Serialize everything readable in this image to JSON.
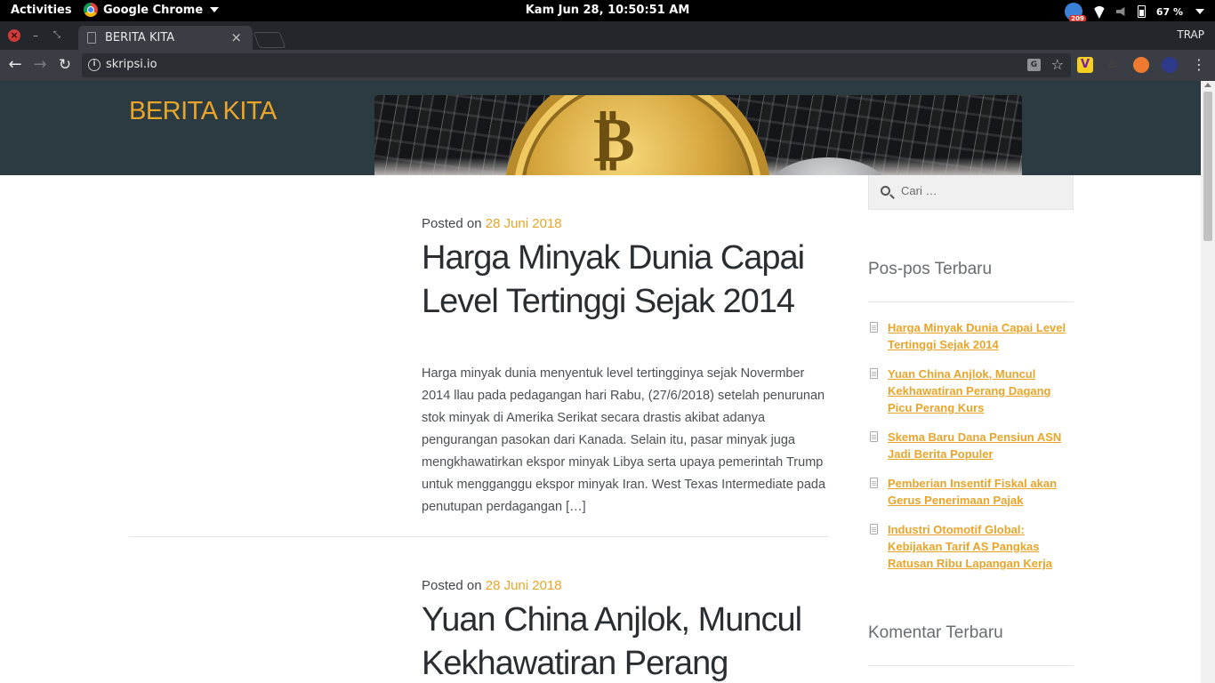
{
  "system_bar": {
    "activities": "Activities",
    "app_name": "Google Chrome",
    "clock": "Kam Jun 28, 10:50:51 AM",
    "notification_count": "209",
    "battery": "67 %"
  },
  "browser": {
    "tab_title": "BERITA KITA",
    "tab_close": "×",
    "profile": "TRAP",
    "url": "skripsi.io",
    "window_close": "×",
    "window_min": "–",
    "window_max": "⤡",
    "nav_back": "←",
    "nav_forward": "→",
    "nav_reload": "↻",
    "bookmark": "☆",
    "menu": "⋮",
    "extension_v": "V"
  },
  "site": {
    "title": "BERITA KITA",
    "header_image_glyph": "₿"
  },
  "posts": [
    {
      "posted_label": "Posted on",
      "date": "28 Juni 2018",
      "title": "Harga Minyak Dunia Capai Level Tertinggi Sejak 2014",
      "excerpt": "Harga minyak dunia menyentuk level tertingginya sejak Novermber 2014 llau pada pedagangan hari Rabu, (27/6/2018) setelah penurunan stok minyak di Amerika Serikat secara drastis akibat adanya pengurangan pasokan dari Kanada. Selain itu, pasar minyak juga mengkhawatirkan ekspor minyak Libya serta upaya pemerintah Trump untuk mengganggu ekspor minyak Iran. West Texas Intermediate pada penutupan perdagangan […]"
    },
    {
      "posted_label": "Posted on",
      "date": "28 Juni 2018",
      "title": "Yuan China Anjlok, Muncul Kekhawatiran Perang"
    }
  ],
  "sidebar": {
    "search_placeholder": "Cari …",
    "recent_title": "Pos-pos Terbaru",
    "recent_posts": [
      "Harga Minyak Dunia Capai Level Tertinggi Sejak 2014",
      "Yuan China Anjlok, Muncul Kekhawatiran Perang Dagang Picu Perang Kurs",
      "Skema Baru Dana Pensiun ASN Jadi Berita Populer",
      "Pemberian Insentif Fiskal akan Gerus Penerimaan Pajak",
      "Industri Otomotif Global: Kebijakan Tarif AS Pangkas Ratusan Ribu Lapangan Kerja"
    ],
    "comments_title": "Komentar Terbaru"
  },
  "colors": {
    "accent": "#e8a52a",
    "header_bg": "#2b3b41",
    "chrome_dark": "#3a3d43"
  }
}
